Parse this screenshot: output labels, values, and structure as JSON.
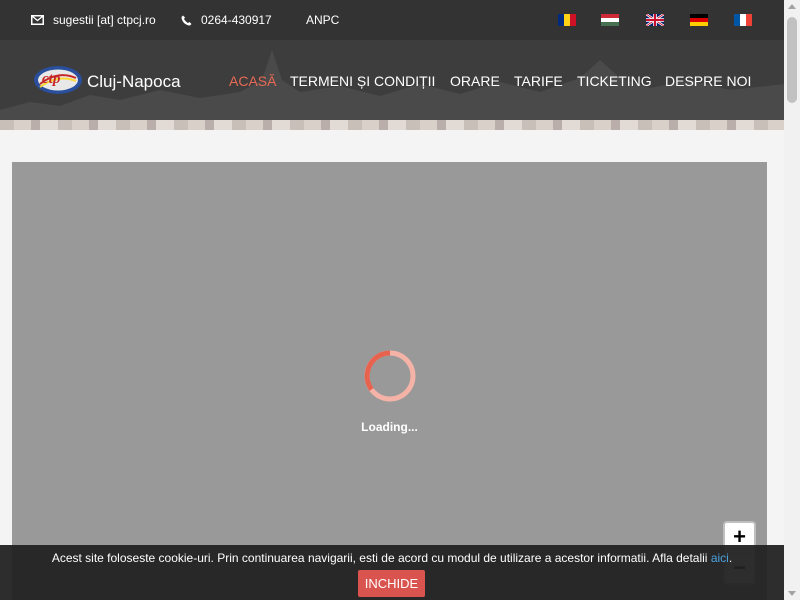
{
  "topbar": {
    "email": "sugestii [at] ctpcj.ro",
    "phone": "0264-430917",
    "anpc": "ANPC",
    "languages": [
      {
        "name": "romanian-flag",
        "colors": [
          "#002b7f",
          "#fcd116",
          "#ce1126"
        ],
        "orientation": "vertical"
      },
      {
        "name": "hungarian-flag",
        "colors": [
          "#ce2939",
          "#ffffff",
          "#477050"
        ],
        "orientation": "horizontal"
      },
      {
        "name": "uk-flag",
        "colors": [
          "#012169",
          "#ffffff",
          "#c8102e"
        ],
        "orientation": "union"
      },
      {
        "name": "german-flag",
        "colors": [
          "#000000",
          "#dd0000",
          "#ffce00"
        ],
        "orientation": "horizontal"
      },
      {
        "name": "french-flag",
        "colors": [
          "#0055a4",
          "#ffffff",
          "#ef4135"
        ],
        "orientation": "vertical"
      }
    ]
  },
  "header": {
    "logo_text": "ctp",
    "brand": "Cluj-Napoca",
    "nav": [
      {
        "label": "ACASĂ",
        "active": true
      },
      {
        "label": "TERMENI ȘI CONDIȚII",
        "active": false
      },
      {
        "label": "ORARE",
        "active": false
      },
      {
        "label": "TARIFE",
        "active": false
      },
      {
        "label": "TICKETING",
        "active": false
      },
      {
        "label": "DESPRE NOI",
        "active": false
      }
    ]
  },
  "map": {
    "loading_text": "Loading...",
    "zoom_in": "+",
    "zoom_out": "−"
  },
  "cookie": {
    "text": "Acest site foloseste cookie-uri. Prin continuarea navigarii, esti de acord cu modul de utilizare a acestor informatii. Afla detalii ",
    "link": "aici",
    "end": ".",
    "button": "INCHIDE"
  },
  "colors": {
    "accent": "#e86a56",
    "topbar": "#333333",
    "map_bg": "#999999",
    "cookie_button": "#d9534f",
    "link": "#4aa3df"
  }
}
